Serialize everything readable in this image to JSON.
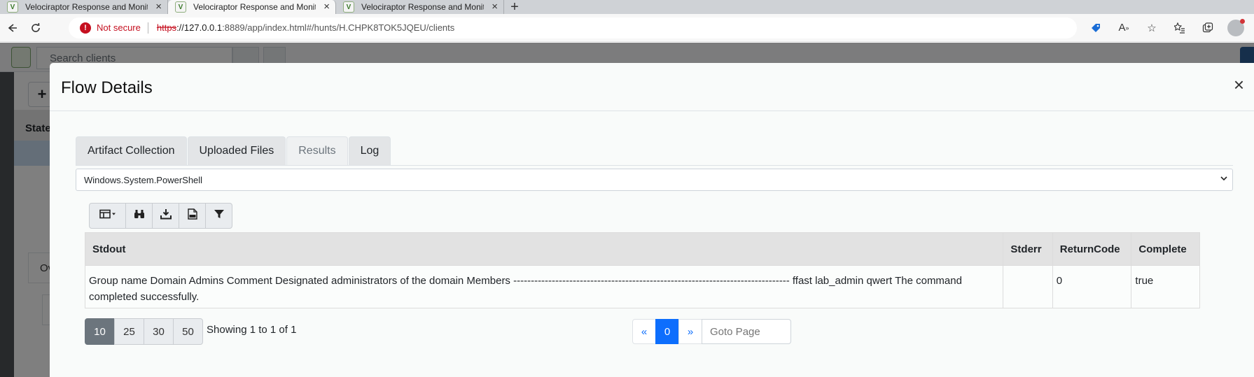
{
  "browser": {
    "tabs": [
      {
        "title": "Velociraptor Response and Monit",
        "active": false
      },
      {
        "title": "Velociraptor Response and Monit",
        "active": true
      },
      {
        "title": "Velociraptor Response and Monit",
        "active": false
      }
    ],
    "new_tab_glyph": "+",
    "security_label": "Not secure",
    "url": {
      "scheme": "https",
      "host": "://127.0.0.1",
      "path": ":8889/app/index.html#/hunts/H.CHPK8TOK5JQEU/clients"
    }
  },
  "app": {
    "search_placeholder": "Search clients",
    "table_header": "State",
    "overview_tab": "Ov"
  },
  "modal": {
    "title": "Flow Details",
    "close_glyph": "×",
    "tabs": [
      {
        "label": "Artifact Collection",
        "active": false
      },
      {
        "label": "Uploaded Files",
        "active": false
      },
      {
        "label": "Results",
        "active": true
      },
      {
        "label": "Log",
        "active": false
      }
    ],
    "artifact_selected": "Windows.System.PowerShell",
    "toolbar_icons": [
      "column-toggle-icon",
      "binoculars-icon",
      "download-icon",
      "csv-file-icon",
      "filter-icon"
    ],
    "table": {
      "columns": [
        "Stdout",
        "Stderr",
        "ReturnCode",
        "Complete"
      ],
      "rows": [
        {
          "stdout": "Group name Domain Admins Comment Designated administrators of the domain Members ------------------------------------------------------------------------------- ffast lab_admin qwert The command completed successfully.",
          "stderr": "",
          "return_code": "0",
          "complete": "true"
        }
      ]
    },
    "page_sizes": [
      "10",
      "25",
      "30",
      "50"
    ],
    "page_size_active": "10",
    "showing_text": "Showing 1 to 1 of 1",
    "pagination": {
      "prev": "«",
      "current": "0",
      "next": "»"
    },
    "goto_placeholder": "Goto Page"
  },
  "colors": {
    "accent": "#0d6efd",
    "not_secure": "#c50f1f",
    "page_size_active": "#6c757d"
  }
}
